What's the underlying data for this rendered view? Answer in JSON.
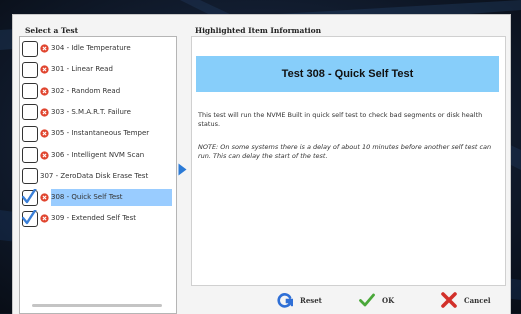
{
  "left_group": {
    "title": "Select a Test"
  },
  "right_group": {
    "title": "Highlighted Item Information"
  },
  "tests": [
    {
      "label": "304 - Idle Temperature",
      "checked": false,
      "status_icon": "error-icon",
      "selected": false
    },
    {
      "label": "301 - Linear Read",
      "checked": false,
      "status_icon": "error-icon",
      "selected": false
    },
    {
      "label": "302 - Random Read",
      "checked": false,
      "status_icon": "error-icon",
      "selected": false
    },
    {
      "label": "303 - S.M.A.R.T. Failure",
      "checked": false,
      "status_icon": "error-icon",
      "selected": false
    },
    {
      "label": "305 - Instantaneous Temper",
      "checked": false,
      "status_icon": "error-icon",
      "selected": false
    },
    {
      "label": "306 - Intelligent NVM Scan",
      "checked": false,
      "status_icon": "error-icon",
      "selected": false
    },
    {
      "label": "307 - ZeroData Disk Erase Test",
      "checked": false,
      "status_icon": null,
      "selected": false
    },
    {
      "label": "308 - Quick Self Test",
      "checked": true,
      "status_icon": "error-icon",
      "selected": true
    },
    {
      "label": "309 - Extended Self Test",
      "checked": true,
      "status_icon": "error-icon",
      "selected": false
    }
  ],
  "info": {
    "title": "Test 308 - Quick Self Test",
    "description": "This test will run the NVME Built in quick self test to check bad segments or disk health status.",
    "note": "NOTE: On some systems there is a delay of about 10 minutes before another self test can run. This can delay the start of the test."
  },
  "buttons": {
    "reset": "Reset",
    "ok": "OK",
    "cancel": "Cancel"
  },
  "colors": {
    "selection": "#99ccff",
    "banner": "#87cefa",
    "error_icon": "#e0442e",
    "check": "#3a7fd8",
    "ok_icon": "#4aa83a",
    "cancel_icon": "#d2302a",
    "reset_icon": "#2f6fd6"
  }
}
